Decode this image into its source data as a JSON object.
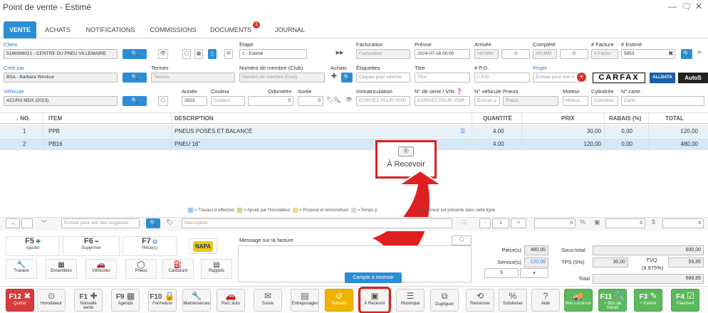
{
  "window": {
    "title": "Point de vente - Estimé"
  },
  "tabs": [
    "VENTE",
    "ACHATS",
    "NOTIFICATIONS",
    "COMMISSIONS",
    "DOCUMENTS",
    "JOURNAL"
  ],
  "documents_badge": "1",
  "form": {
    "client_label": "Client",
    "client_value": "5146086021 - CENTRE DU PNEU VILLEMAIRE",
    "cree_par_label": "Créé par",
    "cree_par_value": "BSA - Barbara Windsor",
    "vehicule_label": "Véhicule",
    "vehicule_value": "ACURA MDX (2023)",
    "etape_label": "Étape",
    "etape_value": "1 - Estimé",
    "termes_label": "Termes",
    "termes_ph": "Termes",
    "membre_label": "Numéro de membre (Club)",
    "membre_ph": "Numéro de membre (Club)",
    "achats_label": "Achats",
    "etiquettes_label": "Étiquettes",
    "etiquettes_ph": "Cliquez pour sélectio",
    "titre_label": "Titre",
    "titre_ph": "Titre",
    "annee_label": "Année",
    "annee_value": "2023",
    "couleur_label": "Couleur",
    "couleur_ph": "Couleur",
    "odometre_label": "Odomètre",
    "odometre_value": "0",
    "sortie_label": "Sortie",
    "sortie_value": "0",
    "facturation_label": "Facturation",
    "facturation_ph": "Facturation",
    "prevue_label": "Prévue",
    "prevue_value": "2024-07-18 00:00",
    "arrivee_label": "Arrivée",
    "arrivee_ph": "HH:MM",
    "complete_label": "Complété",
    "complete_ph": "HH:MM",
    "facture_label": "# Facture",
    "facture_ph": "# Factur",
    "estime_label": "# Estimé",
    "estime_value": "5853",
    "po_label": "# P.O.",
    "po_ph": "# P.O.",
    "projet_label": "Projet",
    "projet_ph": "Écrivez pour voir d",
    "immat_label": "Immatriculation",
    "immat_ph": "ECRIVEZ POUR VOIR",
    "serie_label": "N° de série / VIN",
    "serie_ph": "ECRIVEZ POUR VOIR",
    "nveh_label": "N° véhicule",
    "nveh_ph": "Écrivez p",
    "pneus_label": "Pneus",
    "pneus_ph": "Pneus",
    "moteur_label": "Moteur",
    "moteur_ph": "Moteur",
    "cyl_label": "Cylindrée",
    "cyl_ph": "Cylindrée",
    "carte_label": "N° carte",
    "carte_ph": "Carte",
    "carfax": "CARFAX",
    "alldata": "ALLDATA",
    "autosoft": "AutoS"
  },
  "table": {
    "headers": [
      "↓ NO.",
      "ITEM",
      "DESCRIPTION",
      "QUANTITÉ",
      "PRIX",
      "RABAIS (%)",
      "TOTAL"
    ],
    "rows": [
      {
        "no": "1",
        "item": "PPB",
        "desc": "PNEUS POSÉS ET BALANCÉ",
        "qty": "4.00",
        "prix": "30,00",
        "rabais": "0,00",
        "total": "120,00"
      },
      {
        "no": "2",
        "item": "PB16",
        "desc": "PNEU 16\"",
        "qty": "4.00",
        "prix": "120,00",
        "rabais": "0,00",
        "total": "480,00"
      }
    ]
  },
  "callout": {
    "label": "À Recevoir"
  },
  "legend": [
    "= Travaux à effectuer",
    "= Ajouté par l'horodateur",
    "= Proposé et remis/refusé",
    "= Temps p",
    "= Une erreur est présente dans cette ligne"
  ],
  "entry": {
    "suggest_ph": "Écrivez pour voir des suggestio",
    "desc_ph": "Description",
    "qty": "1",
    "v1": "0",
    "v2": "0",
    "v3": "0",
    "pct": "%",
    "dollar": "$"
  },
  "fkeys": [
    {
      "k": "F5",
      "s": "Ajouter"
    },
    {
      "k": "F6",
      "s": "Supprimer"
    },
    {
      "k": "F7",
      "s": "Pièce(s)"
    }
  ],
  "sidebtns": [
    "Travaux",
    "Ensembles",
    "Véhicules",
    "Pneus",
    "Carburant",
    "Rappels"
  ],
  "napa": "NAPA",
  "message_label": "Message sur la facture",
  "totals": {
    "pieces_label": "Pièce(s)",
    "pieces": "480,00",
    "services_label": "Service(s)",
    "services": "120,00",
    "soustotal_label": "Sous-total",
    "soustotal": "600,00",
    "tps_label": "TPS (5%)",
    "tps": "30,00",
    "tvq_label": "TVQ",
    "tvq_rate": "(9.975%)",
    "tvq": "59,85",
    "total_label": "Total",
    "total": "689,85",
    "dollar": "$"
  },
  "tooltip": "Compte à recevoir",
  "bottom": [
    {
      "k": "F12",
      "t": "Quitter",
      "c": "red",
      "ic": "✖"
    },
    {
      "k": "",
      "t": "Horodateur",
      "c": "",
      "ic": "⊙"
    },
    {
      "k": "F1",
      "t": "Nouvelle vente",
      "c": "",
      "ic": "✚"
    },
    {
      "k": "F9",
      "t": "Agenda",
      "c": "",
      "ic": "▦"
    },
    {
      "k": "F10",
      "t": "Fermeture",
      "c": "",
      "ic": "🔒"
    },
    {
      "k": "",
      "t": "Maintenances",
      "c": "",
      "ic": "🔧"
    },
    {
      "k": "",
      "t": "Parc auto",
      "c": "",
      "ic": "🚗"
    },
    {
      "k": "",
      "t": "Suivie",
      "c": "",
      "ic": "✉"
    },
    {
      "k": "",
      "t": "Entreposages",
      "c": "",
      "ic": "▤"
    },
    {
      "k": "",
      "t": "Retours",
      "c": "yellow",
      "ic": "↺"
    },
    {
      "k": "",
      "t": "À Recevoir",
      "c": "",
      "ic": "▣"
    },
    {
      "k": "",
      "t": "Historique",
      "c": "",
      "ic": "☰"
    },
    {
      "k": "",
      "t": "Dupliquer",
      "c": "",
      "ic": "⧉"
    },
    {
      "k": "",
      "t": "Renverser",
      "c": "",
      "ic": "⟲"
    },
    {
      "k": "",
      "t": "Subdiviser",
      "c": "",
      "ic": "%"
    },
    {
      "k": "",
      "t": "Aide",
      "c": "",
      "ic": "?"
    },
    {
      "k": "",
      "t": "Bon Livraison",
      "c": "green",
      "ic": "🚚"
    },
    {
      "k": "F11",
      "t": "+ Bon de travail",
      "c": "green",
      "ic": "🔧"
    },
    {
      "k": "F3",
      "t": "+ Estimé",
      "c": "green",
      "ic": "✎"
    },
    {
      "k": "F4",
      "t": "Paiement",
      "c": "green",
      "ic": "☑"
    }
  ]
}
